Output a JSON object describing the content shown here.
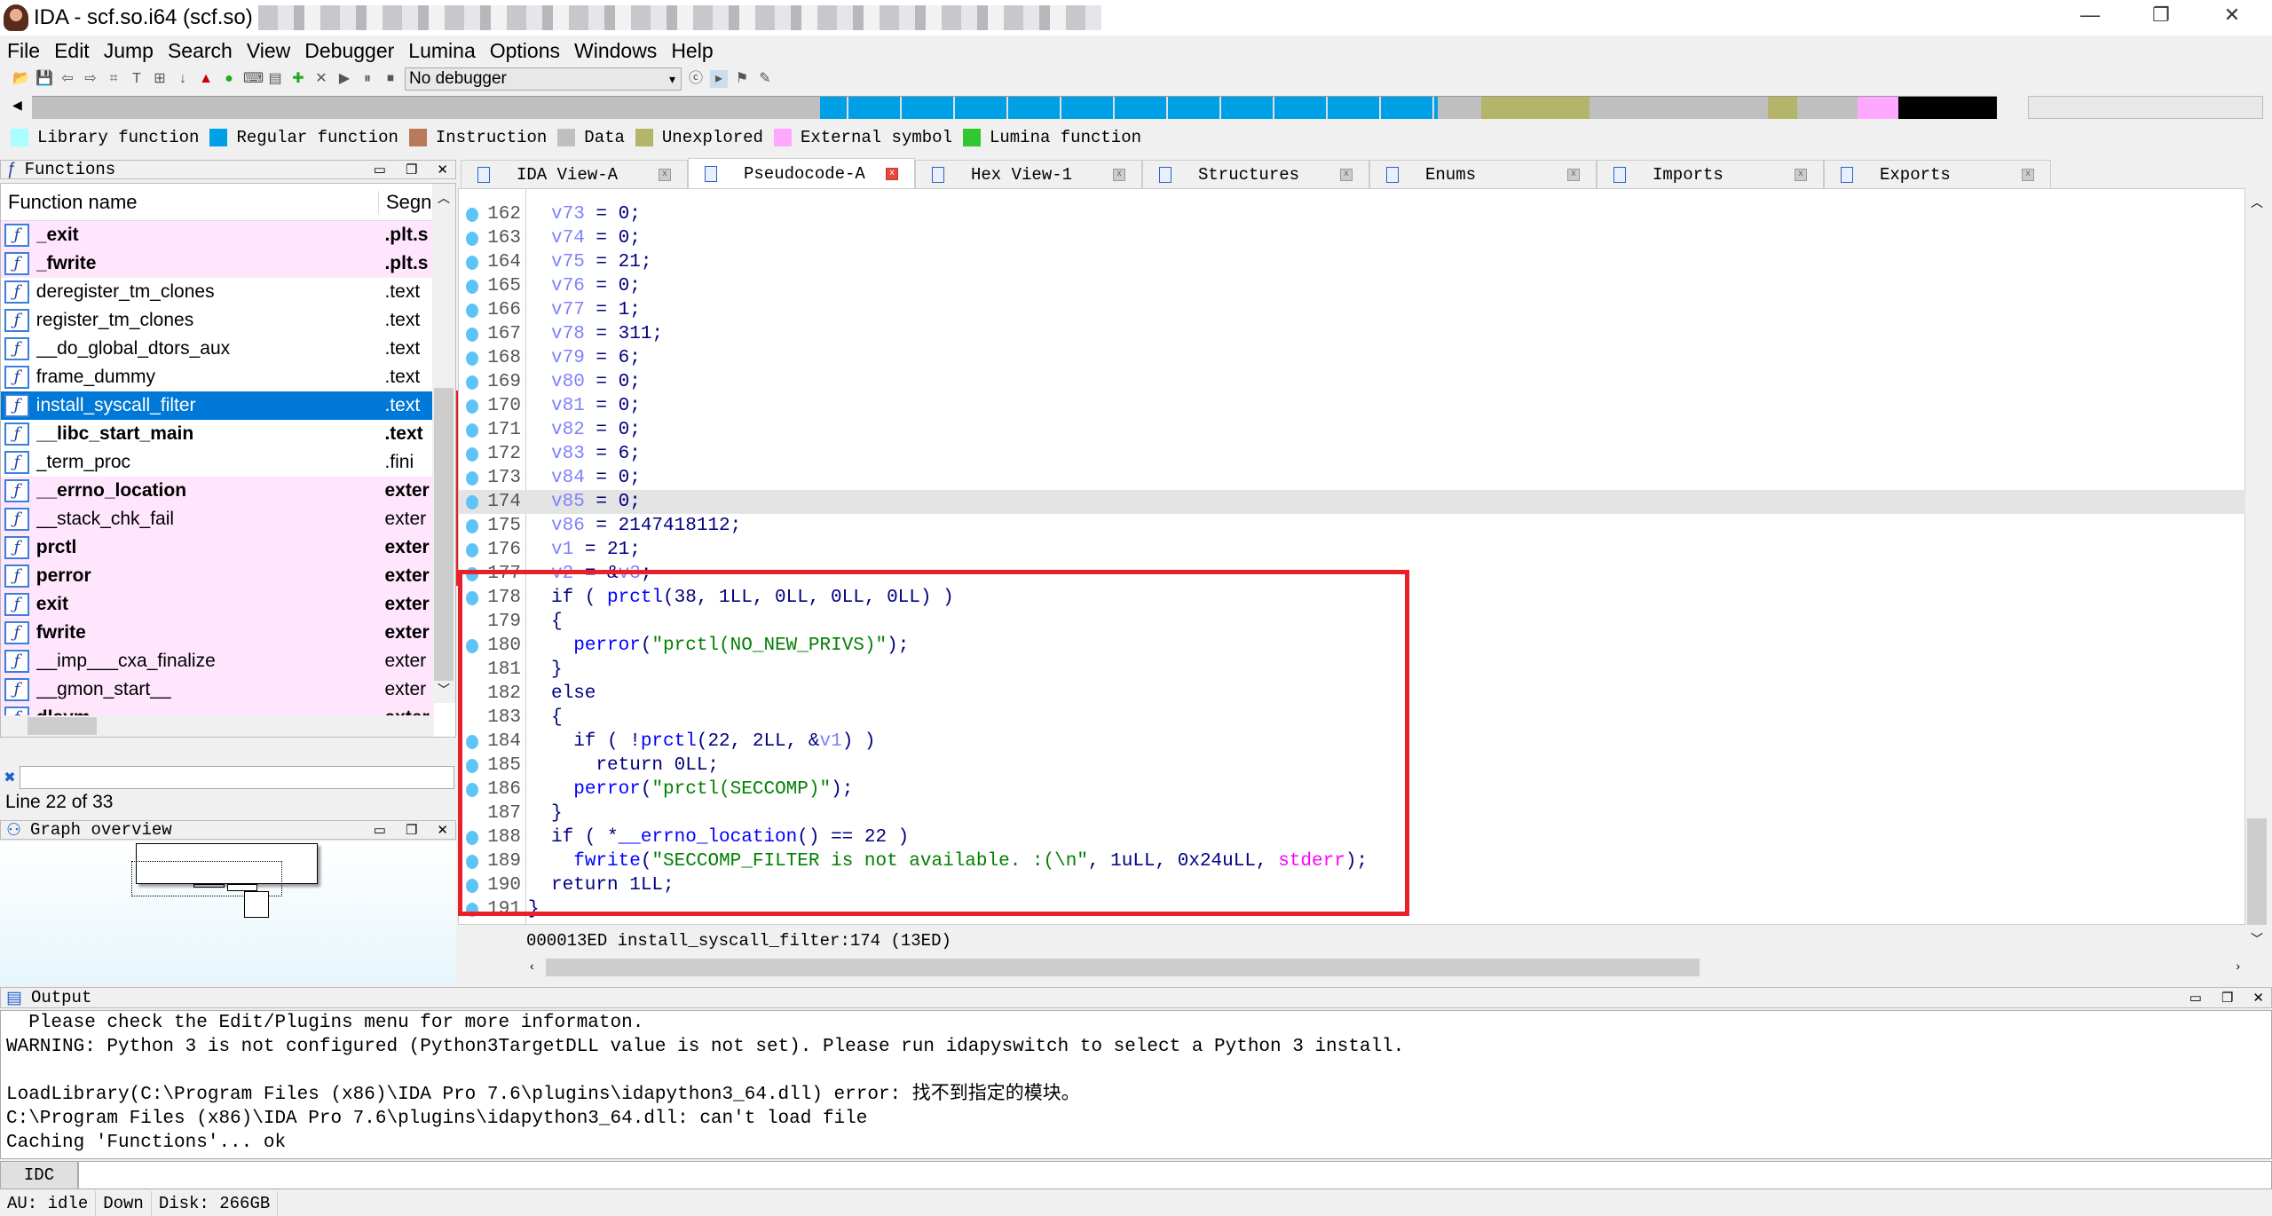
{
  "window": {
    "title": "IDA - scf.so.i64 (scf.so)",
    "minimize": "—",
    "restore": "❐",
    "close": "✕"
  },
  "menu": [
    "File",
    "Edit",
    "Jump",
    "Search",
    "View",
    "Debugger",
    "Lumina",
    "Options",
    "Windows",
    "Help"
  ],
  "toolbar": {
    "debugger_select": "No debugger"
  },
  "legend": [
    {
      "label": "Library function",
      "color": "#a8ffff"
    },
    {
      "label": "Regular function",
      "color": "#00a0e6"
    },
    {
      "label": "Instruction",
      "color": "#b87a5a"
    },
    {
      "label": "Data",
      "color": "#bfbfbf"
    },
    {
      "label": "Unexplored",
      "color": "#b4b46a"
    },
    {
      "label": "External symbol",
      "color": "#ffa8ff"
    },
    {
      "label": "Lumina function",
      "color": "#30c830"
    }
  ],
  "functions_panel": {
    "title": "Functions",
    "col_name": "Function name",
    "col_segment": "Segn",
    "rows": [
      {
        "name": "_exit",
        "segment": ".plt.s",
        "ext": true,
        "bold": true
      },
      {
        "name": "_fwrite",
        "segment": ".plt.s",
        "ext": true,
        "bold": true
      },
      {
        "name": "deregister_tm_clones",
        "segment": ".text"
      },
      {
        "name": "register_tm_clones",
        "segment": ".text"
      },
      {
        "name": "__do_global_dtors_aux",
        "segment": ".text"
      },
      {
        "name": "frame_dummy",
        "segment": ".text"
      },
      {
        "name": "install_syscall_filter",
        "segment": ".text",
        "selected": true
      },
      {
        "name": "__libc_start_main",
        "segment": ".text",
        "bold": true
      },
      {
        "name": "_term_proc",
        "segment": ".fini"
      },
      {
        "name": "__errno_location",
        "segment": "exter",
        "ext": true,
        "bold": true
      },
      {
        "name": "__stack_chk_fail",
        "segment": "exter",
        "ext": true
      },
      {
        "name": "prctl",
        "segment": "exter",
        "ext": true,
        "bold": true
      },
      {
        "name": "perror",
        "segment": "exter",
        "ext": true,
        "bold": true
      },
      {
        "name": "exit",
        "segment": "exter",
        "ext": true,
        "bold": true
      },
      {
        "name": "fwrite",
        "segment": "exter",
        "ext": true,
        "bold": true
      },
      {
        "name": "__imp___cxa_finalize",
        "segment": "exter",
        "ext": true
      },
      {
        "name": "__gmon_start__",
        "segment": "exter",
        "ext": true
      },
      {
        "name": "dlsym",
        "segment": "exter",
        "ext": true,
        "bold": true
      }
    ],
    "filter_value": "",
    "line_status": "Line 22 of 33"
  },
  "graph_overview": {
    "title": "Graph overview"
  },
  "tabs": [
    {
      "label": "IDA View-A"
    },
    {
      "label": "Pseudocode-A",
      "active": true
    },
    {
      "label": "Hex View-1"
    },
    {
      "label": "Structures"
    },
    {
      "label": "Enums"
    },
    {
      "label": "Imports"
    },
    {
      "label": "Exports"
    }
  ],
  "code": [
    {
      "n": "162",
      "dot": true,
      "tok": [
        [
          "v73",
          "var"
        ],
        [
          " = 0;",
          "op"
        ]
      ]
    },
    {
      "n": "163",
      "dot": true,
      "tok": [
        [
          "v74",
          "var"
        ],
        [
          " = 0;",
          "op"
        ]
      ]
    },
    {
      "n": "164",
      "dot": true,
      "tok": [
        [
          "v75",
          "var"
        ],
        [
          " = 21;",
          "op"
        ]
      ]
    },
    {
      "n": "165",
      "dot": true,
      "tok": [
        [
          "v76",
          "var"
        ],
        [
          " = 0;",
          "op"
        ]
      ]
    },
    {
      "n": "166",
      "dot": true,
      "tok": [
        [
          "v77",
          "var"
        ],
        [
          " = 1;",
          "op"
        ]
      ]
    },
    {
      "n": "167",
      "dot": true,
      "tok": [
        [
          "v78",
          "var"
        ],
        [
          " = 311;",
          "op"
        ]
      ]
    },
    {
      "n": "168",
      "dot": true,
      "tok": [
        [
          "v79",
          "var"
        ],
        [
          " = 6;",
          "op"
        ]
      ]
    },
    {
      "n": "169",
      "dot": true,
      "tok": [
        [
          "v80",
          "var"
        ],
        [
          " = 0;",
          "op"
        ]
      ]
    },
    {
      "n": "170",
      "dot": true,
      "tok": [
        [
          "v81",
          "var"
        ],
        [
          " = 0;",
          "op"
        ]
      ]
    },
    {
      "n": "171",
      "dot": true,
      "tok": [
        [
          "v82",
          "var"
        ],
        [
          " = 0;",
          "op"
        ]
      ]
    },
    {
      "n": "172",
      "dot": true,
      "tok": [
        [
          "v83",
          "var"
        ],
        [
          " = 6;",
          "op"
        ]
      ]
    },
    {
      "n": "173",
      "dot": true,
      "tok": [
        [
          "v84",
          "var"
        ],
        [
          " = 0;",
          "op"
        ]
      ]
    },
    {
      "n": "174",
      "dot": true,
      "hl": true,
      "tok": [
        [
          "v85",
          "var"
        ],
        [
          " = 0;",
          "op"
        ]
      ]
    },
    {
      "n": "175",
      "dot": true,
      "tok": [
        [
          "v86",
          "var"
        ],
        [
          " = 2147418112;",
          "op"
        ]
      ]
    },
    {
      "n": "176",
      "dot": true,
      "tok": [
        [
          "v1",
          "var"
        ],
        [
          " = 21;",
          "op"
        ]
      ]
    },
    {
      "n": "177",
      "dot": true,
      "tok": [
        [
          "v2",
          "var"
        ],
        [
          " = &",
          "op"
        ],
        [
          "v3",
          "var"
        ],
        [
          ";",
          "op"
        ]
      ]
    },
    {
      "n": "178",
      "dot": true,
      "tok": [
        [
          "if ( ",
          "op"
        ],
        [
          "prctl",
          "fn"
        ],
        [
          "(38, 1LL, 0LL, 0LL, 0LL) )",
          "op"
        ]
      ]
    },
    {
      "n": "179",
      "dot": false,
      "tok": [
        [
          "{",
          "op"
        ]
      ]
    },
    {
      "n": "180",
      "dot": true,
      "tok": [
        [
          "  ",
          "op"
        ],
        [
          "perror",
          "fn"
        ],
        [
          "(",
          "op"
        ],
        [
          "\"prctl(NO_NEW_PRIVS)\"",
          "str"
        ],
        [
          ");",
          "op"
        ]
      ]
    },
    {
      "n": "181",
      "dot": false,
      "tok": [
        [
          "}",
          "op"
        ]
      ]
    },
    {
      "n": "182",
      "dot": false,
      "tok": [
        [
          "else",
          "op"
        ]
      ]
    },
    {
      "n": "183",
      "dot": false,
      "tok": [
        [
          "{",
          "op"
        ]
      ]
    },
    {
      "n": "184",
      "dot": true,
      "tok": [
        [
          "  if ( !",
          "op"
        ],
        [
          "prctl",
          "fn"
        ],
        [
          "(22, 2LL, &",
          "op"
        ],
        [
          "v1",
          "var"
        ],
        [
          ") )",
          "op"
        ]
      ]
    },
    {
      "n": "185",
      "dot": true,
      "tok": [
        [
          "    return 0LL;",
          "op"
        ]
      ]
    },
    {
      "n": "186",
      "dot": true,
      "tok": [
        [
          "  ",
          "op"
        ],
        [
          "perror",
          "fn"
        ],
        [
          "(",
          "op"
        ],
        [
          "\"prctl(SECCOMP)\"",
          "str"
        ],
        [
          ");",
          "op"
        ]
      ]
    },
    {
      "n": "187",
      "dot": false,
      "tok": [
        [
          "}",
          "op"
        ]
      ]
    },
    {
      "n": "188",
      "dot": true,
      "tok": [
        [
          "if ( *",
          "op"
        ],
        [
          "__errno_location",
          "fn"
        ],
        [
          "() == 22 )",
          "op"
        ]
      ]
    },
    {
      "n": "189",
      "dot": true,
      "tok": [
        [
          "  ",
          "op"
        ],
        [
          "fwrite",
          "fn"
        ],
        [
          "(",
          "op"
        ],
        [
          "\"SECCOMP_FILTER is not available. :(\\n\"",
          "str"
        ],
        [
          ", 1uLL, 0x24uLL, ",
          "op"
        ],
        [
          "stderr",
          "glob"
        ],
        [
          ");",
          "op"
        ]
      ]
    },
    {
      "n": "190",
      "dot": true,
      "tok": [
        [
          "return 1LL;",
          "op"
        ]
      ]
    },
    {
      "n": "191",
      "dot": true,
      "tok": [
        [
          "}",
          "op"
        ]
      ],
      "outdent": true
    }
  ],
  "code_status": "000013ED install_syscall_filter:174 (13ED)",
  "output": {
    "title": "Output",
    "lines": [
      "  Please check the Edit/Plugins menu for more informaton.",
      "WARNING: Python 3 is not configured (Python3TargetDLL value is not set). Please run idapyswitch to select a Python 3 install.",
      "",
      "LoadLibrary(C:\\Program Files (x86)\\IDA Pro 7.6\\plugins\\idapython3_64.dll) error: 找不到指定的模块。",
      "C:\\Program Files (x86)\\IDA Pro 7.6\\plugins\\idapython3_64.dll: can't load file",
      "Caching 'Functions'... ok"
    ]
  },
  "idc": {
    "label": "IDC",
    "value": ""
  },
  "status": {
    "au": "AU:  idle",
    "dir": "Down",
    "disk": "Disk: 266GB"
  }
}
